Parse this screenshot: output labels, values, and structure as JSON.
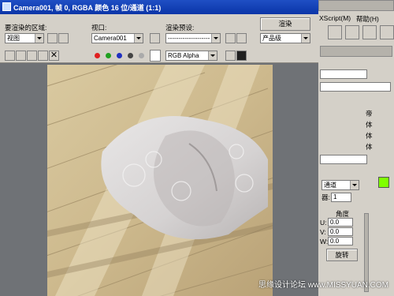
{
  "window": {
    "title": "Camera001, 帧 0, RGBA 颜色 16 位/通道 (1:1)"
  },
  "panel": {
    "area_label": "要渲染的区域:",
    "area_value": "视图",
    "viewport_label": "视口:",
    "viewport_value": "Camera001",
    "preset_label": "渲染预设:",
    "preset_value": "--------------------",
    "render_button": "渲染",
    "mode_value": "产品级",
    "channel_value": "RGB Alpha"
  },
  "right_ui": {
    "menu_script": "XScript(M)",
    "menu_help": "帮助(H)",
    "tab_labels": [
      "帝",
      "体",
      "体",
      "体"
    ],
    "spinner_label": "器:",
    "spinner_value": "1",
    "channel_combo": "通道",
    "angle_label": "角度",
    "u_label": "U:",
    "u_value": "0.0",
    "v_label": "V:",
    "v_value": "0.0",
    "w_label": "W:",
    "w_value": "0.0",
    "rotate_button": "旋转",
    "accent_color": "#7fff00"
  },
  "watermark": {
    "left_text": "思缘设计论坛",
    "right_text": "www.MISSYUAN.COM"
  }
}
